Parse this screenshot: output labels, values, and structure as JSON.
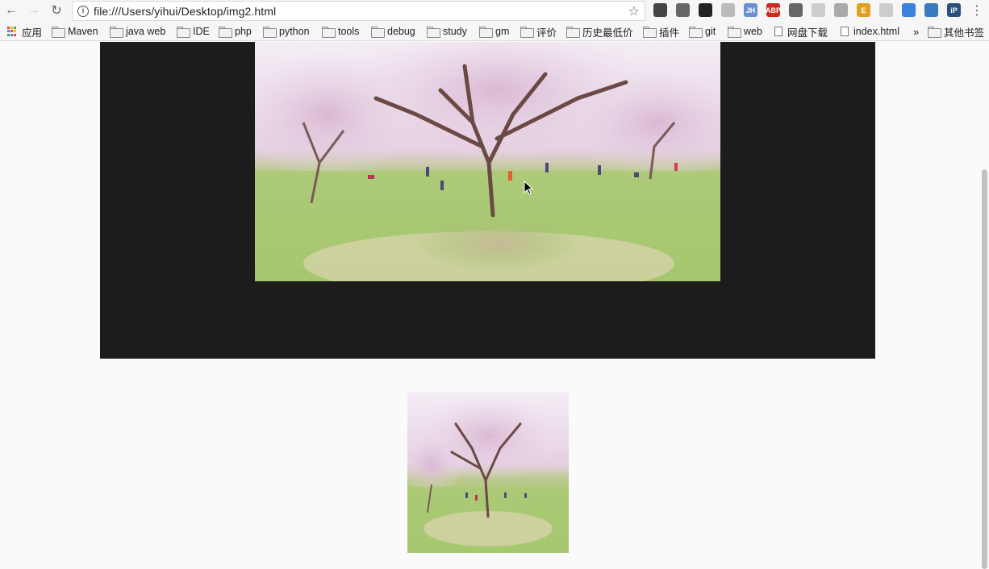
{
  "browser": {
    "url": "file:///Users/yihui/Desktop/img2.html",
    "back_label": "←",
    "forward_label": "→",
    "reload_label": "↻",
    "star_label": "☆",
    "menu_label": "⋮",
    "extensions": [
      {
        "name": "puzzle-extension-icon",
        "text": "",
        "color": "#444444"
      },
      {
        "name": "qr-extension-icon",
        "text": "",
        "color": "#666666"
      },
      {
        "name": "qrcode-extension-icon",
        "text": "",
        "color": "#222222"
      },
      {
        "name": "globe-extension-icon",
        "text": "",
        "color": "#bbbbbb"
      },
      {
        "name": "jh-extension-icon",
        "text": "JH",
        "color": "#6b8fd4"
      },
      {
        "name": "abp-extension-icon",
        "text": "ABP",
        "color": "#d0281e"
      },
      {
        "name": "gear-extension-icon",
        "text": "",
        "color": "#666666"
      },
      {
        "name": "tree-extension-icon",
        "text": "",
        "color": "#cccccc"
      },
      {
        "name": "check-extension-icon",
        "text": "",
        "color": "#aaaaaa"
      },
      {
        "name": "e-extension-icon",
        "text": "E",
        "color": "#e0a020"
      },
      {
        "name": "doc-extension-icon",
        "text": "",
        "color": "#cccccc"
      },
      {
        "name": "pocket-extension-icon",
        "text": "",
        "color": "#3b82e0"
      },
      {
        "name": "s-extension-icon",
        "text": "",
        "color": "#3a7bbf"
      },
      {
        "name": "ip-extension-icon",
        "text": "iP",
        "color": "#2a4f7a"
      }
    ]
  },
  "bookmarks": {
    "apps_label": "应用",
    "items": [
      {
        "label": "Maven",
        "type": "folder"
      },
      {
        "label": "java web",
        "type": "folder"
      },
      {
        "label": "IDE",
        "type": "folder"
      },
      {
        "label": "php",
        "type": "folder"
      },
      {
        "label": "python",
        "type": "folder"
      },
      {
        "label": "tools",
        "type": "folder"
      },
      {
        "label": "debug",
        "type": "folder"
      },
      {
        "label": "study",
        "type": "folder"
      },
      {
        "label": "gm",
        "type": "folder"
      },
      {
        "label": "评价",
        "type": "folder"
      },
      {
        "label": "历史最低价",
        "type": "folder"
      },
      {
        "label": "插件",
        "type": "folder"
      },
      {
        "label": "git",
        "type": "folder"
      },
      {
        "label": "web",
        "type": "folder"
      },
      {
        "label": "网盘下载",
        "type": "page"
      },
      {
        "label": "index.html",
        "type": "page"
      }
    ],
    "overflow_label": "»",
    "other_label": "其他书签"
  },
  "content": {
    "large_image_name": "cherry-blossom-photo",
    "small_image_name": "cherry-blossom-thumbnail"
  },
  "colors": {
    "stage": "#1c1c1c",
    "page": "#fafafa",
    "sky": "#f3ecf4",
    "blossom": "#e8cfe3",
    "grass": "#9cc36a"
  }
}
